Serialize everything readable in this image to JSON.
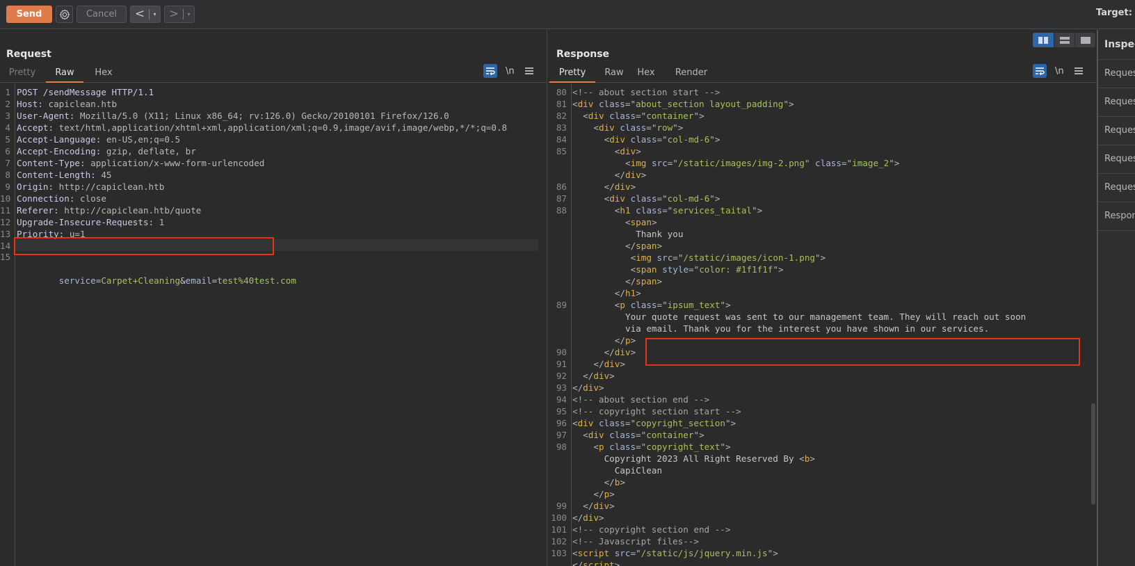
{
  "toolbar": {
    "send_label": "Send",
    "settings_icon": "gear-icon",
    "cancel_label": "Cancel",
    "back_label": "<",
    "forward_label": ">",
    "dropdown_glyph": "▾",
    "target_label": "Target: h"
  },
  "request": {
    "title": "Request",
    "tabs": [
      {
        "label": "Pretty",
        "state": "inactive"
      },
      {
        "label": "Raw",
        "state": "active"
      },
      {
        "label": "Hex",
        "state": "inactive"
      }
    ],
    "icons": {
      "wrap": "word-wrap-icon",
      "newline": "\\n",
      "menu": "hamburger-menu-icon"
    },
    "lines": [
      {
        "n": "1",
        "key": "POST /sendMessage HTTP/1.1",
        "val": ""
      },
      {
        "n": "2",
        "key": "Host:",
        "val": " capiclean.htb"
      },
      {
        "n": "3",
        "key": "User-Agent:",
        "val": " Mozilla/5.0 (X11; Linux x86_64; rv:126.0) Gecko/20100101 Firefox/126.0"
      },
      {
        "n": "4",
        "key": "Accept:",
        "val": " text/html,application/xhtml+xml,application/xml;q=0.9,image/avif,image/webp,*/*;q=0.8"
      },
      {
        "n": "5",
        "key": "Accept-Language:",
        "val": " en-US,en;q=0.5"
      },
      {
        "n": "6",
        "key": "Accept-Encoding:",
        "val": " gzip, deflate, br"
      },
      {
        "n": "7",
        "key": "Content-Type:",
        "val": " application/x-www-form-urlencoded"
      },
      {
        "n": "8",
        "key": "Content-Length:",
        "val": " 45"
      },
      {
        "n": "9",
        "key": "Origin:",
        "val": " http://capiclean.htb"
      },
      {
        "n": "10",
        "key": "Connection:",
        "val": " close"
      },
      {
        "n": "11",
        "key": "Referer:",
        "val": " http://capiclean.htb/quote"
      },
      {
        "n": "12",
        "key": "Upgrade-Insecure-Requests:",
        "val": " 1"
      },
      {
        "n": "13",
        "key": "Priority:",
        "val": " u=1"
      },
      {
        "n": "14",
        "key": "",
        "val": ""
      }
    ],
    "body_line": {
      "n": "15",
      "param1_key": "service",
      "param1_value": "Carpet+Cleaning",
      "amp": "&",
      "param2_key": "email",
      "param2_value": "test%40test.com",
      "eq": "="
    }
  },
  "response": {
    "title": "Response",
    "tabs": [
      {
        "label": "Pretty",
        "state": "active"
      },
      {
        "label": "Raw",
        "state": "inactive"
      },
      {
        "label": "Hex",
        "state": "inactive"
      },
      {
        "label": "Render",
        "state": "inactive"
      }
    ],
    "layout_toggle": [
      "split-horizontal-icon",
      "split-vertical-icon",
      "single-pane-icon"
    ],
    "lines": [
      {
        "n": "80",
        "indent": 2,
        "html": "c:<!-- about section start -->"
      },
      {
        "n": "81",
        "indent": 2,
        "tag": "div",
        "attrs": [
          [
            "class",
            "about_section layout_padding"
          ]
        ]
      },
      {
        "n": "82",
        "indent": 3,
        "tag": "div",
        "attrs": [
          [
            "class",
            "container"
          ]
        ]
      },
      {
        "n": "83",
        "indent": 4,
        "tag": "div",
        "attrs": [
          [
            "class",
            "row"
          ]
        ]
      },
      {
        "n": "84",
        "indent": 5,
        "tag": "div",
        "attrs": [
          [
            "class",
            "col-md-6"
          ]
        ]
      },
      {
        "n": "85",
        "indent": 6,
        "tag": "div",
        "attrs": []
      },
      {
        "n": "",
        "indent": 7,
        "tag": "img",
        "attrs": [
          [
            "src",
            "/static/images/img-2.png"
          ],
          [
            "class",
            "image_2"
          ]
        ]
      },
      {
        "n": "",
        "indent": 6,
        "close": "div"
      },
      {
        "n": "86",
        "indent": 5,
        "close": "div"
      },
      {
        "n": "87",
        "indent": 5,
        "tag": "div",
        "attrs": [
          [
            "class",
            "col-md-6"
          ]
        ]
      },
      {
        "n": "88",
        "indent": 6,
        "tag": "h1",
        "attrs": [
          [
            "class",
            "services_taital"
          ]
        ]
      },
      {
        "n": "",
        "indent": 7,
        "tag": "span",
        "attrs": []
      },
      {
        "n": "",
        "indent": 8,
        "text": "Thank you"
      },
      {
        "n": "",
        "indent": 7,
        "close": "span"
      },
      {
        "n": "",
        "indent": 7.5,
        "tag": "img",
        "attrs": [
          [
            "src",
            "/static/images/icon-1.png"
          ]
        ]
      },
      {
        "n": "",
        "indent": 7.5,
        "tag": "span",
        "attrs": [
          [
            "style",
            "color: #1f1f1f"
          ]
        ]
      },
      {
        "n": "",
        "indent": 7,
        "close": "span"
      },
      {
        "n": "",
        "indent": 6,
        "close": "h1"
      },
      {
        "n": "89",
        "indent": 6,
        "tag": "p",
        "attrs": [
          [
            "class",
            "ipsum_text"
          ]
        ]
      },
      {
        "n": "",
        "indent": 7,
        "text": "Your quote request was sent to our management team. They will reach out soon"
      },
      {
        "n": "",
        "indent": 7,
        "text": "via email. Thank you for the interest you have shown in our services."
      },
      {
        "n": "",
        "indent": 6,
        "close": "p"
      },
      {
        "n": "90",
        "indent": 5,
        "close": "div"
      },
      {
        "n": "91",
        "indent": 4,
        "close": "div"
      },
      {
        "n": "92",
        "indent": 3,
        "close": "div"
      },
      {
        "n": "93",
        "indent": 2,
        "close": "div"
      },
      {
        "n": "94",
        "indent": 2,
        "html": "c:<!-- about section end -->"
      },
      {
        "n": "95",
        "indent": 2,
        "html": "c:<!-- copyright section start -->"
      },
      {
        "n": "96",
        "indent": 2,
        "tag": "div",
        "attrs": [
          [
            "class",
            "copyright_section"
          ]
        ]
      },
      {
        "n": "97",
        "indent": 3,
        "tag": "div",
        "attrs": [
          [
            "class",
            "container"
          ]
        ]
      },
      {
        "n": "98",
        "indent": 4,
        "tag": "p",
        "attrs": [
          [
            "class",
            "copyright_text"
          ]
        ]
      },
      {
        "n": "",
        "indent": 5,
        "text": "Copyright 2023 All Right Reserved By ",
        "trail_tag": "b"
      },
      {
        "n": "",
        "indent": 6,
        "text": "CapiClean"
      },
      {
        "n": "",
        "indent": 5,
        "close": "b"
      },
      {
        "n": "",
        "indent": 4,
        "close": "p"
      },
      {
        "n": "99",
        "indent": 3,
        "close": "div"
      },
      {
        "n": "100",
        "indent": 2,
        "close": "div"
      },
      {
        "n": "101",
        "indent": 2,
        "html": "c:<!-- copyright section end -->"
      },
      {
        "n": "102",
        "indent": 2,
        "html": "c:<!-- Javascript files-->"
      },
      {
        "n": "103",
        "indent": 2,
        "tag": "script",
        "attrs": [
          [
            "src",
            "/static/js/jquery.min.js"
          ]
        ]
      },
      {
        "n": "",
        "indent": 2,
        "close": "script"
      }
    ]
  },
  "inspector": {
    "title": "Inspector",
    "rows": [
      "Request attributes",
      "Request query parameters",
      "Request body parameters",
      "Request cookies",
      "Request headers",
      "Response headers"
    ]
  },
  "highlight_color": "#e8321b",
  "accent_color": "#e07b4c"
}
